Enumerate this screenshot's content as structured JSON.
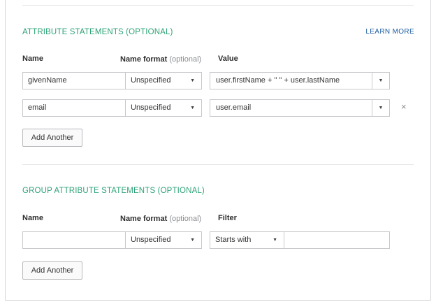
{
  "attribute_section": {
    "title": "ATTRIBUTE STATEMENTS (OPTIONAL)",
    "learn_more": "LEARN MORE",
    "col_name": "Name",
    "col_format": "Name format",
    "col_format_hint": "(optional)",
    "col_value": "Value",
    "rows": [
      {
        "name": "givenName",
        "format": "Unspecified",
        "value": "user.firstName + \" \" + user.lastName"
      },
      {
        "name": "email",
        "format": "Unspecified",
        "value": "user.email"
      }
    ],
    "remove_glyph": "×",
    "add_button": "Add Another"
  },
  "group_section": {
    "title": "GROUP ATTRIBUTE STATEMENTS (OPTIONAL)",
    "col_name": "Name",
    "col_format": "Name format",
    "col_format_hint": "(optional)",
    "col_filter": "Filter",
    "row": {
      "name": "",
      "format": "Unspecified",
      "filter_type": "Starts with",
      "filter_value": ""
    },
    "add_button": "Add Another"
  },
  "icons": {
    "caret": "caret-down-icon",
    "remove": "close-icon"
  },
  "colors": {
    "section_title": "#2fa378",
    "link": "#1c5c9f",
    "border": "#c8c8cc"
  }
}
